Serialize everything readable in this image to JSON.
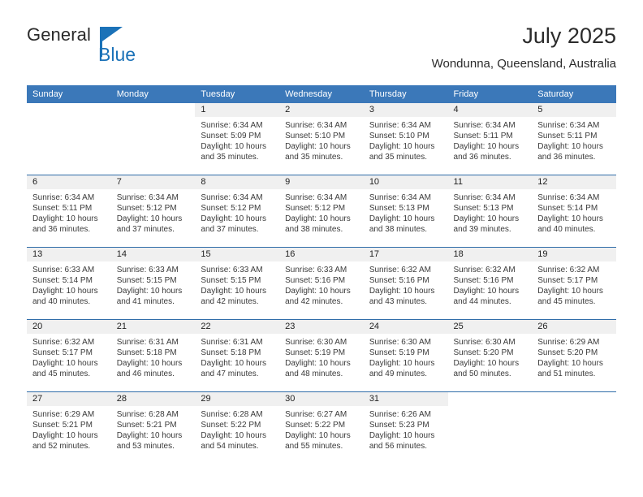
{
  "branding": {
    "logo_text_primary": "General",
    "logo_text_secondary": "Blue",
    "accent_color": "#1b72b8"
  },
  "header": {
    "title": "July 2025",
    "location": "Wondunna, Queensland, Australia"
  },
  "calendar": {
    "header_bg": "#3b78b9",
    "daynum_bg": "#f0f0f0",
    "weekday_headers": [
      "Sunday",
      "Monday",
      "Tuesday",
      "Wednesday",
      "Thursday",
      "Friday",
      "Saturday"
    ],
    "weeks": [
      [
        {
          "day": "",
          "blank": true,
          "lines": []
        },
        {
          "day": "",
          "blank": true,
          "lines": []
        },
        {
          "day": "1",
          "lines": [
            "Sunrise: 6:34 AM",
            "Sunset: 5:09 PM",
            "Daylight: 10 hours",
            "and 35 minutes."
          ]
        },
        {
          "day": "2",
          "lines": [
            "Sunrise: 6:34 AM",
            "Sunset: 5:10 PM",
            "Daylight: 10 hours",
            "and 35 minutes."
          ]
        },
        {
          "day": "3",
          "lines": [
            "Sunrise: 6:34 AM",
            "Sunset: 5:10 PM",
            "Daylight: 10 hours",
            "and 35 minutes."
          ]
        },
        {
          "day": "4",
          "lines": [
            "Sunrise: 6:34 AM",
            "Sunset: 5:11 PM",
            "Daylight: 10 hours",
            "and 36 minutes."
          ]
        },
        {
          "day": "5",
          "lines": [
            "Sunrise: 6:34 AM",
            "Sunset: 5:11 PM",
            "Daylight: 10 hours",
            "and 36 minutes."
          ]
        }
      ],
      [
        {
          "day": "6",
          "lines": [
            "Sunrise: 6:34 AM",
            "Sunset: 5:11 PM",
            "Daylight: 10 hours",
            "and 36 minutes."
          ]
        },
        {
          "day": "7",
          "lines": [
            "Sunrise: 6:34 AM",
            "Sunset: 5:12 PM",
            "Daylight: 10 hours",
            "and 37 minutes."
          ]
        },
        {
          "day": "8",
          "lines": [
            "Sunrise: 6:34 AM",
            "Sunset: 5:12 PM",
            "Daylight: 10 hours",
            "and 37 minutes."
          ]
        },
        {
          "day": "9",
          "lines": [
            "Sunrise: 6:34 AM",
            "Sunset: 5:12 PM",
            "Daylight: 10 hours",
            "and 38 minutes."
          ]
        },
        {
          "day": "10",
          "lines": [
            "Sunrise: 6:34 AM",
            "Sunset: 5:13 PM",
            "Daylight: 10 hours",
            "and 38 minutes."
          ]
        },
        {
          "day": "11",
          "lines": [
            "Sunrise: 6:34 AM",
            "Sunset: 5:13 PM",
            "Daylight: 10 hours",
            "and 39 minutes."
          ]
        },
        {
          "day": "12",
          "lines": [
            "Sunrise: 6:34 AM",
            "Sunset: 5:14 PM",
            "Daylight: 10 hours",
            "and 40 minutes."
          ]
        }
      ],
      [
        {
          "day": "13",
          "lines": [
            "Sunrise: 6:33 AM",
            "Sunset: 5:14 PM",
            "Daylight: 10 hours",
            "and 40 minutes."
          ]
        },
        {
          "day": "14",
          "lines": [
            "Sunrise: 6:33 AM",
            "Sunset: 5:15 PM",
            "Daylight: 10 hours",
            "and 41 minutes."
          ]
        },
        {
          "day": "15",
          "lines": [
            "Sunrise: 6:33 AM",
            "Sunset: 5:15 PM",
            "Daylight: 10 hours",
            "and 42 minutes."
          ]
        },
        {
          "day": "16",
          "lines": [
            "Sunrise: 6:33 AM",
            "Sunset: 5:16 PM",
            "Daylight: 10 hours",
            "and 42 minutes."
          ]
        },
        {
          "day": "17",
          "lines": [
            "Sunrise: 6:32 AM",
            "Sunset: 5:16 PM",
            "Daylight: 10 hours",
            "and 43 minutes."
          ]
        },
        {
          "day": "18",
          "lines": [
            "Sunrise: 6:32 AM",
            "Sunset: 5:16 PM",
            "Daylight: 10 hours",
            "and 44 minutes."
          ]
        },
        {
          "day": "19",
          "lines": [
            "Sunrise: 6:32 AM",
            "Sunset: 5:17 PM",
            "Daylight: 10 hours",
            "and 45 minutes."
          ]
        }
      ],
      [
        {
          "day": "20",
          "lines": [
            "Sunrise: 6:32 AM",
            "Sunset: 5:17 PM",
            "Daylight: 10 hours",
            "and 45 minutes."
          ]
        },
        {
          "day": "21",
          "lines": [
            "Sunrise: 6:31 AM",
            "Sunset: 5:18 PM",
            "Daylight: 10 hours",
            "and 46 minutes."
          ]
        },
        {
          "day": "22",
          "lines": [
            "Sunrise: 6:31 AM",
            "Sunset: 5:18 PM",
            "Daylight: 10 hours",
            "and 47 minutes."
          ]
        },
        {
          "day": "23",
          "lines": [
            "Sunrise: 6:30 AM",
            "Sunset: 5:19 PM",
            "Daylight: 10 hours",
            "and 48 minutes."
          ]
        },
        {
          "day": "24",
          "lines": [
            "Sunrise: 6:30 AM",
            "Sunset: 5:19 PM",
            "Daylight: 10 hours",
            "and 49 minutes."
          ]
        },
        {
          "day": "25",
          "lines": [
            "Sunrise: 6:30 AM",
            "Sunset: 5:20 PM",
            "Daylight: 10 hours",
            "and 50 minutes."
          ]
        },
        {
          "day": "26",
          "lines": [
            "Sunrise: 6:29 AM",
            "Sunset: 5:20 PM",
            "Daylight: 10 hours",
            "and 51 minutes."
          ]
        }
      ],
      [
        {
          "day": "27",
          "lines": [
            "Sunrise: 6:29 AM",
            "Sunset: 5:21 PM",
            "Daylight: 10 hours",
            "and 52 minutes."
          ]
        },
        {
          "day": "28",
          "lines": [
            "Sunrise: 6:28 AM",
            "Sunset: 5:21 PM",
            "Daylight: 10 hours",
            "and 53 minutes."
          ]
        },
        {
          "day": "29",
          "lines": [
            "Sunrise: 6:28 AM",
            "Sunset: 5:22 PM",
            "Daylight: 10 hours",
            "and 54 minutes."
          ]
        },
        {
          "day": "30",
          "lines": [
            "Sunrise: 6:27 AM",
            "Sunset: 5:22 PM",
            "Daylight: 10 hours",
            "and 55 minutes."
          ]
        },
        {
          "day": "31",
          "lines": [
            "Sunrise: 6:26 AM",
            "Sunset: 5:23 PM",
            "Daylight: 10 hours",
            "and 56 minutes."
          ]
        },
        {
          "day": "",
          "blank": true,
          "lines": []
        },
        {
          "day": "",
          "blank": true,
          "lines": []
        }
      ]
    ]
  }
}
